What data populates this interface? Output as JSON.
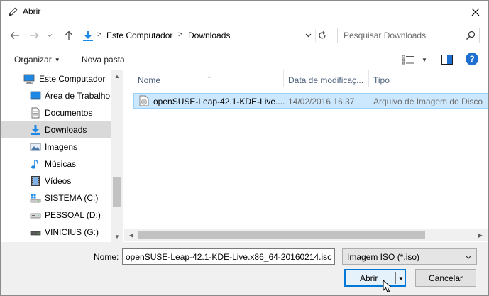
{
  "window": {
    "title": "Abrir"
  },
  "address": {
    "crumbs": [
      "Este Computador",
      "Downloads"
    ],
    "separator": ">"
  },
  "search": {
    "placeholder": "Pesquisar Downloads"
  },
  "toolbar": {
    "organize": "Organizar",
    "new_folder": "Nova pasta",
    "help": "?"
  },
  "nav": {
    "items": [
      {
        "label": "Este Computador",
        "icon": "computer-icon"
      },
      {
        "label": "Área de Trabalho",
        "icon": "desktop-icon"
      },
      {
        "label": "Documentos",
        "icon": "documents-icon"
      },
      {
        "label": "Downloads",
        "icon": "downloads-icon",
        "selected": true
      },
      {
        "label": "Imagens",
        "icon": "pictures-icon"
      },
      {
        "label": "Músicas",
        "icon": "music-icon"
      },
      {
        "label": "Vídeos",
        "icon": "videos-icon"
      },
      {
        "label": "SISTEMA (C:)",
        "icon": "system-drive-icon"
      },
      {
        "label": "PESSOAL (D:)",
        "icon": "drive-icon"
      },
      {
        "label": "VINICIUS (G:)",
        "icon": "usb-drive-icon"
      }
    ]
  },
  "columns": {
    "name": "Nome",
    "date": "Data de modificaç...",
    "type": "Tipo"
  },
  "files": [
    {
      "name": "openSUSE-Leap-42.1-KDE-Live....",
      "date": "14/02/2016 16:37",
      "type": "Arquivo de Imagem do Disco",
      "icon": "iso-file-icon"
    }
  ],
  "bottom": {
    "name_label": "Nome:",
    "name_value": "openSUSE-Leap-42.1-KDE-Live.x86_64-20160214.iso",
    "file_type": "Imagem ISO (*.iso)",
    "open_label": "Abrir",
    "cancel_label": "Cancelar"
  },
  "colors": {
    "accent": "#0078d7",
    "selection": "#cce8ff",
    "folder_blue": "#1e88e5"
  }
}
